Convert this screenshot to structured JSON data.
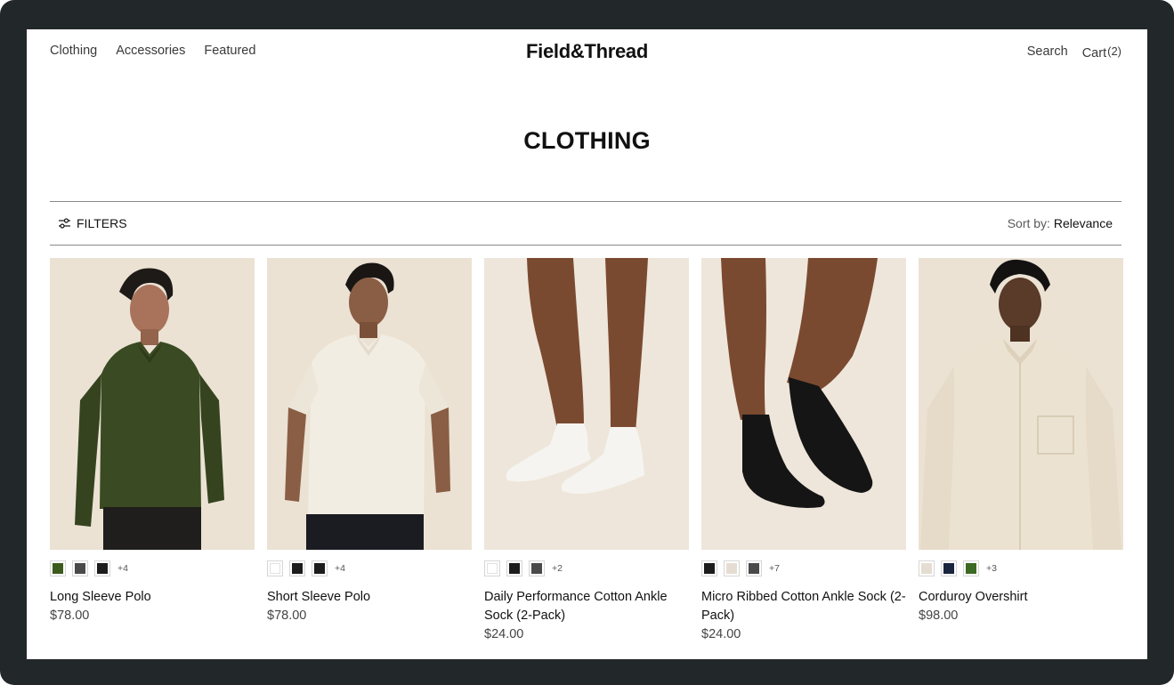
{
  "store": {
    "name": "Field&Thread"
  },
  "nav": {
    "left": [
      {
        "label": "Clothing"
      },
      {
        "label": "Accessories"
      },
      {
        "label": "Featured"
      }
    ],
    "search_label": "Search",
    "cart_label": "Cart",
    "cart_count": "(2)"
  },
  "page": {
    "title": "CLOTHING"
  },
  "toolbar": {
    "filters_label": "FILTERS",
    "sort_prefix": "Sort by:",
    "sort_value": "Relevance"
  },
  "products": [
    {
      "name": "Long Sleeve Polo",
      "price": "$78.00",
      "swatches": [
        "#3d5a1e",
        "#4a4a4a",
        "#1c1c1c"
      ],
      "more_colors": "+4",
      "image": "model-olive-long-sleeve-polo"
    },
    {
      "name": "Short Sleeve Polo",
      "price": "$78.00",
      "swatches": [
        "#ffffff",
        "#1c1c1c",
        "#1c1c1c"
      ],
      "more_colors": "+4",
      "image": "model-cream-short-sleeve-polo"
    },
    {
      "name": "Daily Performance Cotton Ankle Sock (2-Pack)",
      "price": "$24.00",
      "swatches": [
        "#ffffff",
        "#1c1c1c",
        "#4a4a4a"
      ],
      "more_colors": "+2",
      "image": "white-ankle-socks"
    },
    {
      "name": "Micro Ribbed Cotton Ankle Sock (2-Pack)",
      "price": "$24.00",
      "swatches": [
        "#1c1c1c",
        "#e6ddd2",
        "#4a4a4a"
      ],
      "more_colors": "+7",
      "image": "black-ankle-socks"
    },
    {
      "name": "Corduroy Overshirt",
      "price": "$98.00",
      "swatches": [
        "#e6ddd2",
        "#1a2540",
        "#3d6a22"
      ],
      "more_colors": "+3",
      "image": "model-cream-corduroy-overshirt"
    }
  ]
}
